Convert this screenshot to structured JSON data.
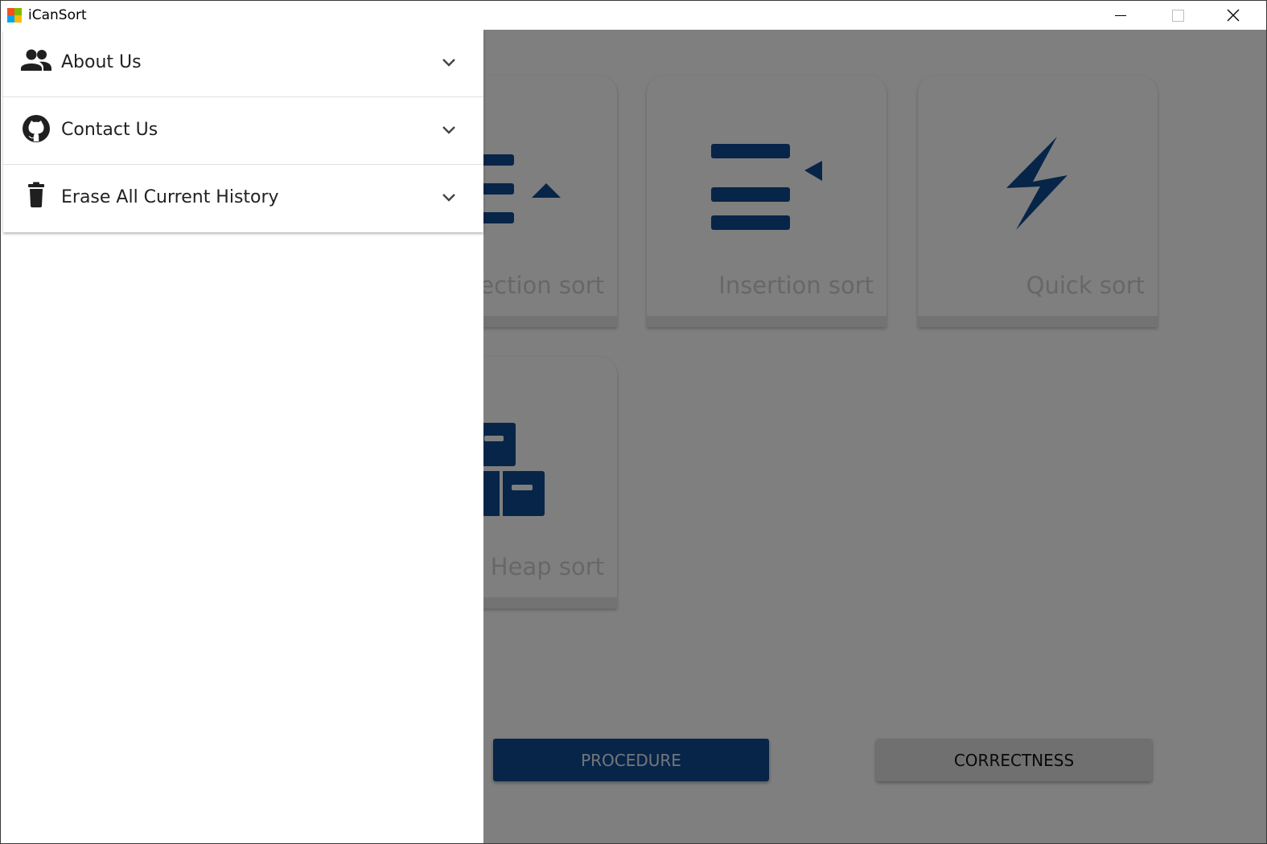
{
  "window": {
    "title": "iCanSort"
  },
  "drawer": {
    "items": [
      {
        "label": "About Us",
        "icon": "people-icon"
      },
      {
        "label": "Contact Us",
        "icon": "github-icon"
      },
      {
        "label": "Erase All Current History",
        "icon": "trash-icon"
      }
    ]
  },
  "cards": [
    {
      "label": "ection sort",
      "icon": "selection-sort-icon"
    },
    {
      "label": "Insertion sort",
      "icon": "insertion-sort-icon"
    },
    {
      "label": "Quick sort",
      "icon": "lightning-icon"
    },
    {
      "label": "Heap sort",
      "icon": "heap-boxes-icon"
    }
  ],
  "buttons": {
    "procedure": "PROCEDURE",
    "correctness": "CORRECTNESS"
  },
  "colors": {
    "accent": "#0e4a91",
    "scrim": "rgba(0,0,0,0.5)"
  }
}
